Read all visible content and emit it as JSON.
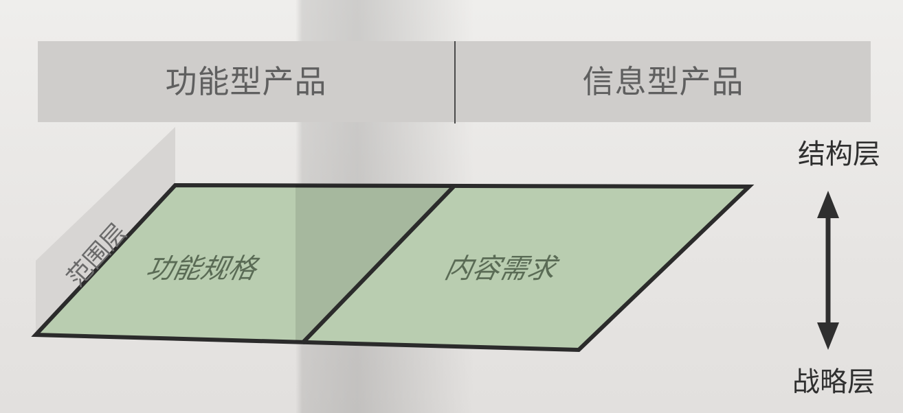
{
  "header": {
    "left_label": "功能型产品",
    "right_label": "信息型产品"
  },
  "plane": {
    "side_label": "范围层",
    "left_label": "功能规格",
    "right_label": "内容需求"
  },
  "axis": {
    "top_label": "结构层",
    "bottom_label": "战略层"
  },
  "colors": {
    "plane_fill": "#b9cdb0",
    "plane_stroke": "#2b2b2b",
    "header_fill": "#cfcdcb",
    "side_fill": "#d3d1cf"
  }
}
